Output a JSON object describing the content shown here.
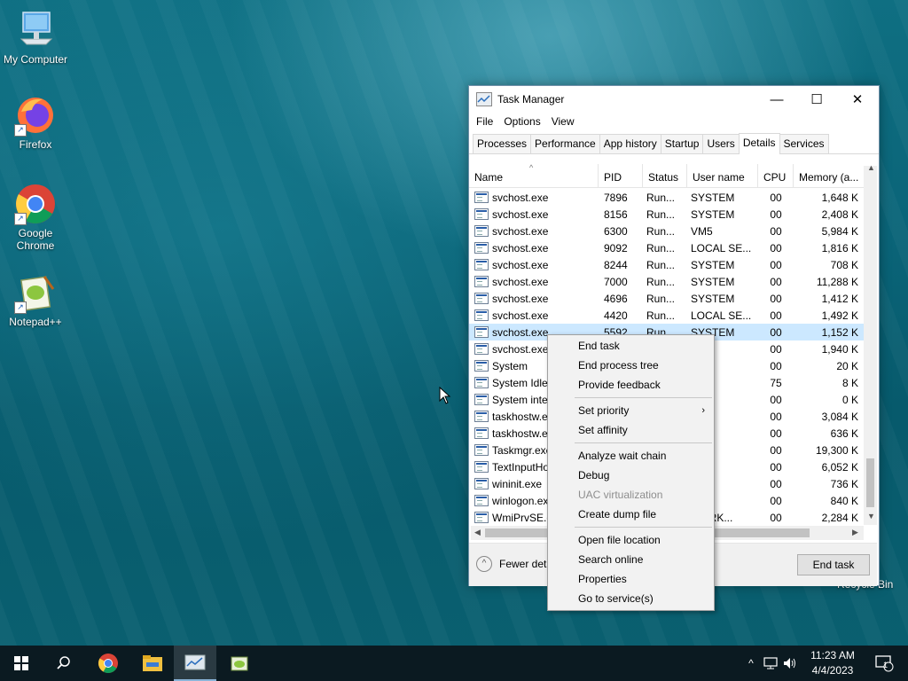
{
  "desktop": {
    "icons": [
      {
        "label": "My Computer"
      },
      {
        "label": "Firefox"
      },
      {
        "label": "Google Chrome"
      },
      {
        "label": "Notepad++"
      }
    ],
    "recycle_bin": "Recycle Bin"
  },
  "task_manager": {
    "title": "Task Manager",
    "controls": {
      "minimize": "—",
      "maximize": "☐",
      "close": "✕"
    },
    "menu": [
      "File",
      "Options",
      "View"
    ],
    "tabs": [
      "Processes",
      "Performance",
      "App history",
      "Startup",
      "Users",
      "Details",
      "Services"
    ],
    "active_tab": "Details",
    "columns": [
      "Name",
      "PID",
      "Status",
      "User name",
      "CPU",
      "Memory (a..."
    ],
    "rows": [
      {
        "name": "svchost.exe",
        "pid": "7896",
        "status": "Run...",
        "user": "SYSTEM",
        "cpu": "00",
        "mem": "1,648 K"
      },
      {
        "name": "svchost.exe",
        "pid": "8156",
        "status": "Run...",
        "user": "SYSTEM",
        "cpu": "00",
        "mem": "2,408 K"
      },
      {
        "name": "svchost.exe",
        "pid": "6300",
        "status": "Run...",
        "user": "VM5",
        "cpu": "00",
        "mem": "5,984 K"
      },
      {
        "name": "svchost.exe",
        "pid": "9092",
        "status": "Run...",
        "user": "LOCAL SE...",
        "cpu": "00",
        "mem": "1,816 K"
      },
      {
        "name": "svchost.exe",
        "pid": "8244",
        "status": "Run...",
        "user": "SYSTEM",
        "cpu": "00",
        "mem": "708 K"
      },
      {
        "name": "svchost.exe",
        "pid": "7000",
        "status": "Run...",
        "user": "SYSTEM",
        "cpu": "00",
        "mem": "11,288 K"
      },
      {
        "name": "svchost.exe",
        "pid": "4696",
        "status": "Run...",
        "user": "SYSTEM",
        "cpu": "00",
        "mem": "1,412 K"
      },
      {
        "name": "svchost.exe",
        "pid": "4420",
        "status": "Run...",
        "user": "LOCAL SE...",
        "cpu": "00",
        "mem": "1,492 K"
      },
      {
        "name": "svchost.exe",
        "pid": "5592",
        "status": "Run...",
        "user": "SYSTEM",
        "cpu": "00",
        "mem": "1,152 K"
      },
      {
        "name": "svchost.exe",
        "pid": "",
        "status": "",
        "user": "TEM",
        "cpu": "00",
        "mem": "1,940 K"
      },
      {
        "name": "System",
        "pid": "",
        "status": "",
        "user": "TEM",
        "cpu": "00",
        "mem": "20 K"
      },
      {
        "name": "System Idle P",
        "pid": "",
        "status": "",
        "user": "TEM",
        "cpu": "75",
        "mem": "8 K"
      },
      {
        "name": "System interr",
        "pid": "",
        "status": "",
        "user": "TEM",
        "cpu": "00",
        "mem": "0 K"
      },
      {
        "name": "taskhostw.exe",
        "pid": "",
        "status": "",
        "user": "",
        "cpu": "00",
        "mem": "3,084 K"
      },
      {
        "name": "taskhostw.exe",
        "pid": "",
        "status": "",
        "user": "",
        "cpu": "00",
        "mem": "636 K"
      },
      {
        "name": "Taskmgr.exe",
        "pid": "",
        "status": "",
        "user": "",
        "cpu": "00",
        "mem": "19,300 K"
      },
      {
        "name": "TextInputHos",
        "pid": "",
        "status": "",
        "user": "",
        "cpu": "00",
        "mem": "6,052 K"
      },
      {
        "name": "wininit.exe",
        "pid": "",
        "status": "",
        "user": "TEM",
        "cpu": "00",
        "mem": "736 K"
      },
      {
        "name": "winlogon.exe",
        "pid": "",
        "status": "",
        "user": "TEM",
        "cpu": "00",
        "mem": "840 K"
      },
      {
        "name": "WmiPrvSE.exe",
        "pid": "",
        "status": "",
        "user": "WORK...",
        "cpu": "00",
        "mem": "2,284 K"
      }
    ],
    "selected_row": 8,
    "fewer_details": "Fewer details",
    "end_task_button": "End task"
  },
  "context_menu": {
    "items": [
      {
        "label": "End task",
        "enabled": true
      },
      {
        "label": "End process tree",
        "enabled": true
      },
      {
        "label": "Provide feedback",
        "enabled": true
      },
      {
        "label": "Set priority",
        "enabled": true,
        "submenu": true
      },
      {
        "label": "Set affinity",
        "enabled": true
      },
      {
        "label": "Analyze wait chain",
        "enabled": true
      },
      {
        "label": "Debug",
        "enabled": true
      },
      {
        "label": "UAC virtualization",
        "enabled": false
      },
      {
        "label": "Create dump file",
        "enabled": true
      },
      {
        "label": "Open file location",
        "enabled": true
      },
      {
        "label": "Search online",
        "enabled": true
      },
      {
        "label": "Properties",
        "enabled": true
      },
      {
        "label": "Go to service(s)",
        "enabled": true
      }
    ]
  },
  "taskbar": {
    "clock_time": "11:23 AM",
    "clock_date": "4/4/2023",
    "notification_count": "1"
  },
  "colors": {
    "selection": "#cce8ff",
    "taskbar": "#0b1a21"
  }
}
